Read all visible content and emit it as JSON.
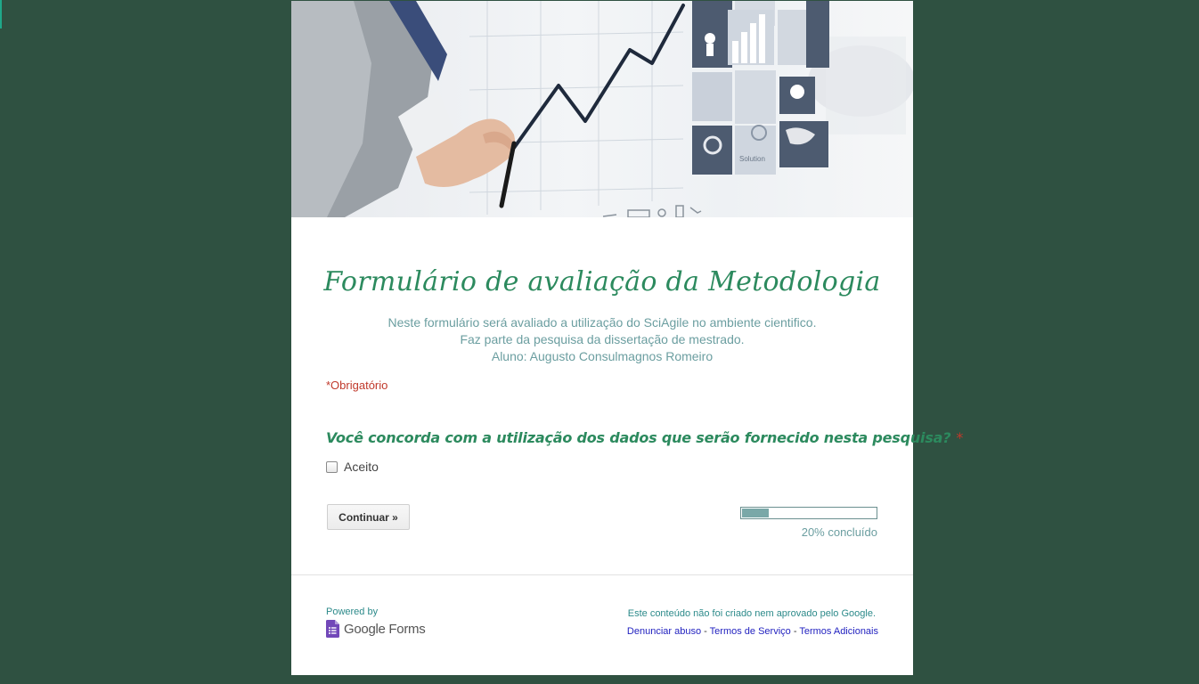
{
  "form": {
    "title": "Formulário de avaliação da Metodologia",
    "description": [
      "Neste formulário será avaliado a utilização do SciAgile no ambiente cientifico.",
      "Faz parte da pesquisa da dissertação de mestrado.",
      "Aluno: Augusto Consulmagnos Romeiro"
    ],
    "required_note": "*Obrigatório",
    "question": {
      "text": "Você concorda com a utilização dos dados que serão fornecido nesta pesquisa?",
      "required_mark": "*",
      "option_label": "Aceito",
      "checked": false
    },
    "continue_label": "Continuar »",
    "progress": {
      "fraction": 0.2,
      "label": "20% concluído"
    }
  },
  "header_image": {
    "chart_label": "Solution"
  },
  "footer": {
    "powered_by": "Powered by",
    "logo_text": "Google Forms",
    "disclaimer": "Este conteúdo não foi criado nem aprovado pelo Google.",
    "links": [
      "Denunciar abuso",
      "Termos de Serviço",
      "Termos Adicionais"
    ],
    "separator": " - "
  },
  "colors": {
    "background": "#2f5141",
    "title": "#2c8a5e",
    "description": "#6b9ea0",
    "required": "#c0392b",
    "link": "#1f1fbf",
    "progress_fill": "#7aa8a8"
  }
}
